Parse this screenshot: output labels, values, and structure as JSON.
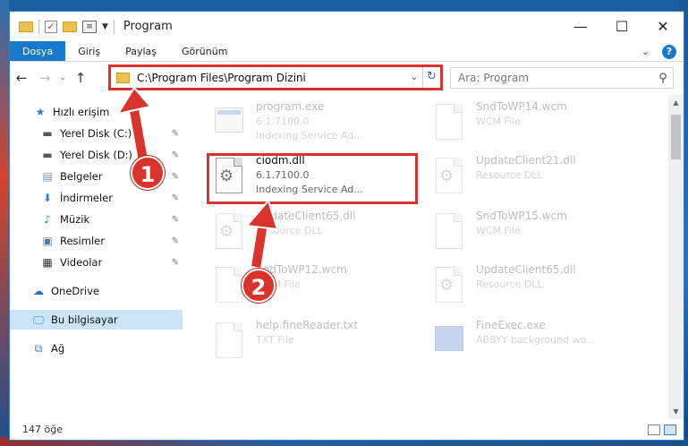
{
  "window": {
    "title": "Program",
    "minimize": "—",
    "maximize": "☐",
    "close": "✕"
  },
  "ribbon": {
    "tabs": [
      "Dosya",
      "Giriş",
      "Paylaş",
      "Görünüm"
    ],
    "expand": "⌄",
    "help": "?"
  },
  "nav": {
    "back": "←",
    "forward": "→",
    "recent": "⌄",
    "up": "↑",
    "address": "C:\\Program Files\\Program Dizini",
    "search_placeholder": "Ara: Program"
  },
  "sidebar": {
    "items": [
      {
        "label": "Hızlı erişim",
        "icon": "star-icon"
      },
      {
        "label": "Yerel Disk (C:)",
        "icon": "drive-icon",
        "pinned": true
      },
      {
        "label": "Yerel Disk (D:)",
        "icon": "drive-icon",
        "pinned": true
      },
      {
        "label": "Belgeler",
        "icon": "documents-icon",
        "pinned": true
      },
      {
        "label": "İndirmeler",
        "icon": "download-icon",
        "pinned": true
      },
      {
        "label": "Müzik",
        "icon": "music-icon",
        "pinned": true
      },
      {
        "label": "Resimler",
        "icon": "pictures-icon",
        "pinned": true
      },
      {
        "label": "Videolar",
        "icon": "videos-icon",
        "pinned": true
      },
      {
        "label": "OneDrive",
        "icon": "cloud-icon"
      },
      {
        "label": "Bu bilgisayar",
        "icon": "computer-icon",
        "selected": true
      },
      {
        "label": "Ağ",
        "icon": "network-icon"
      }
    ]
  },
  "files": [
    {
      "name": "program.exe",
      "line2": "6.1.7100.0",
      "line3": "Indexing Service Ad...",
      "type": "exe"
    },
    {
      "name": "SndToWP14.wcm",
      "line2": "WCM File",
      "line3": "",
      "type": "doc"
    },
    {
      "name": "ciodm.dll",
      "line2": "6.1.7100.0",
      "line3": "Indexing Service Ad...",
      "type": "dll"
    },
    {
      "name": "UpdateClient21.dll",
      "line2": "Resource DLL",
      "line3": "",
      "type": "dll"
    },
    {
      "name": "UpdateClient65.dll",
      "line2": "Resource DLL",
      "line3": "",
      "type": "dll"
    },
    {
      "name": "SndToWP15.wcm",
      "line2": "WCM File",
      "line3": "",
      "type": "doc"
    },
    {
      "name": "SndToWP12.wcm",
      "line2": "WCM File",
      "line3": "",
      "type": "doc"
    },
    {
      "name": "UpdateClient65.dll",
      "line2": "Resource DLL",
      "line3": "",
      "type": "dll"
    },
    {
      "name": "help.fineReader.txt",
      "line2": "TXT File",
      "line3": "",
      "type": "doc"
    },
    {
      "name": "FineExec.exe",
      "line2": "ABBYY background wo...",
      "line3": "",
      "type": "exe-blue"
    }
  ],
  "status": {
    "count": "147 öğe"
  },
  "annotations": {
    "step1": "1",
    "step2": "2",
    "accent_color": "#d9332b"
  }
}
